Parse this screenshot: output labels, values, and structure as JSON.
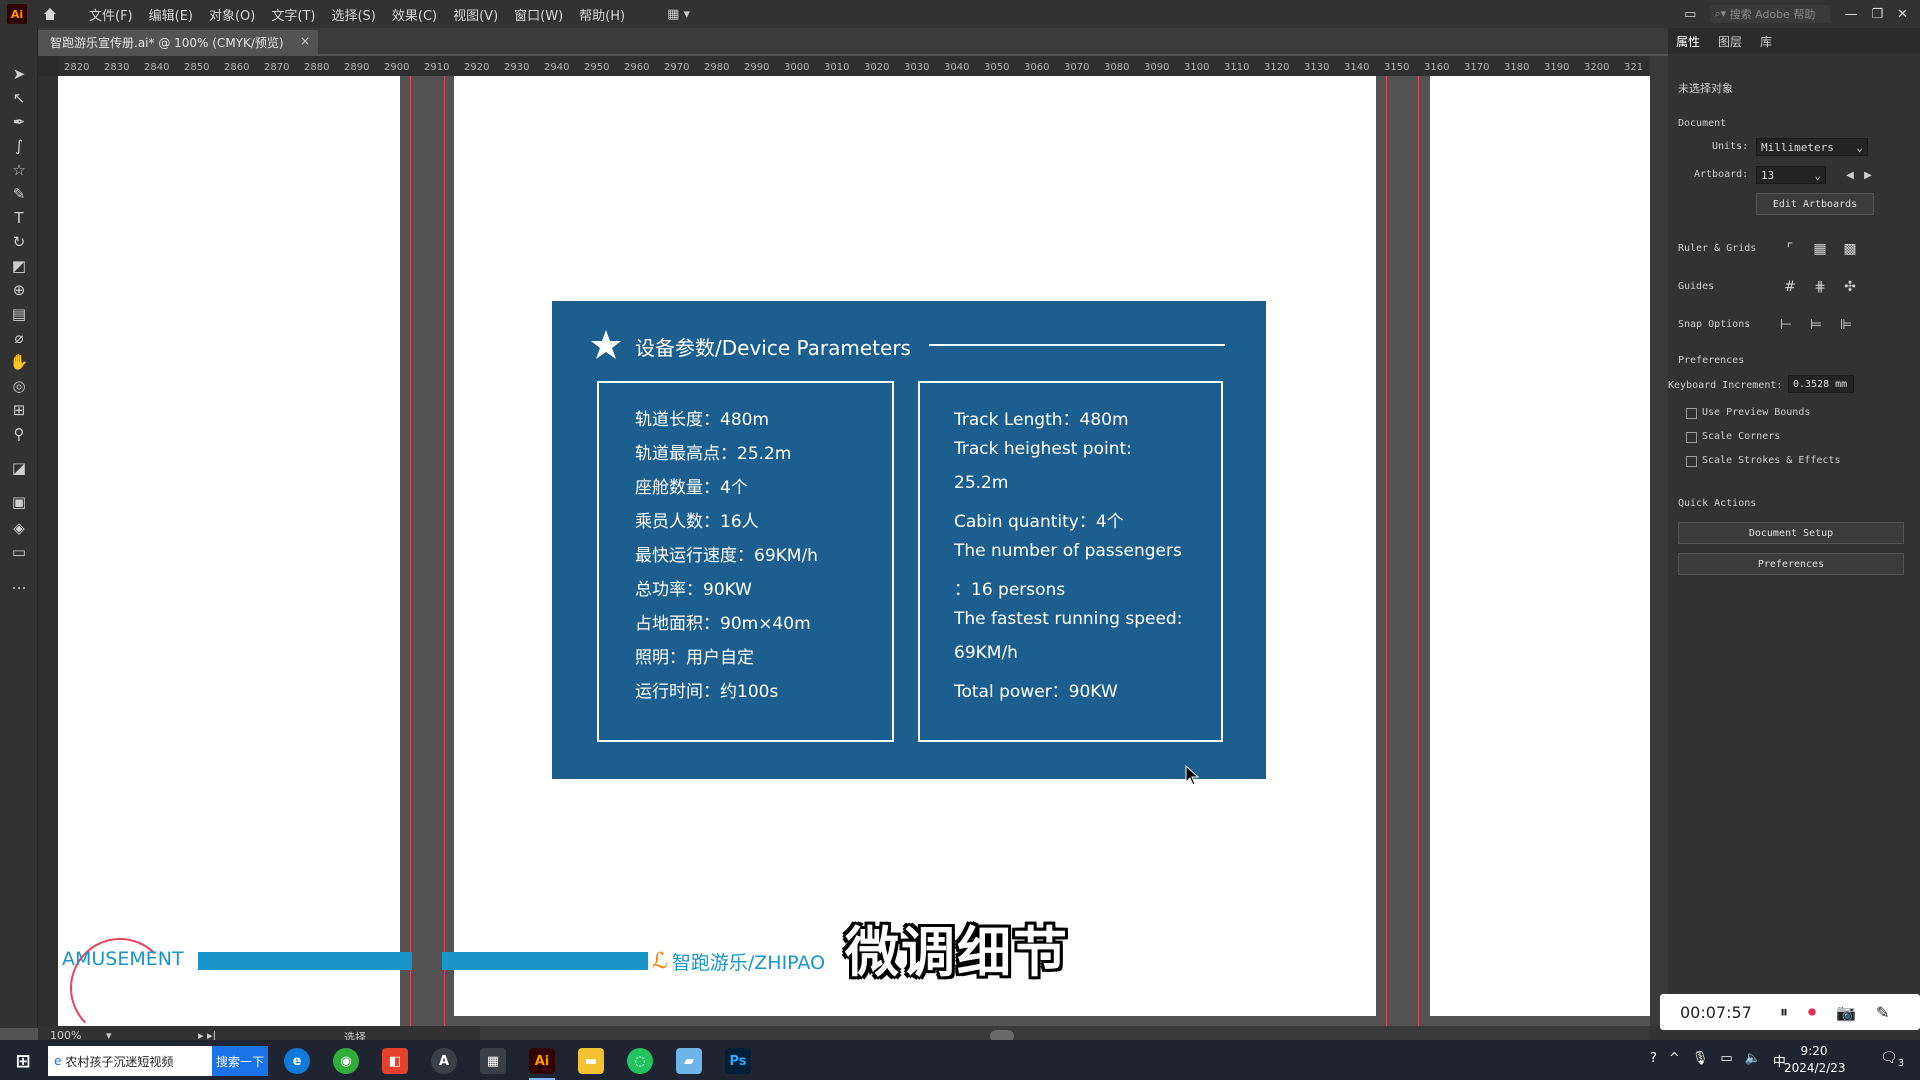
{
  "menubar": {
    "app_logo": "Ai",
    "menus": [
      "文件(F)",
      "编辑(E)",
      "对象(O)",
      "文字(T)",
      "选择(S)",
      "效果(C)",
      "视图(V)",
      "窗口(W)",
      "帮助(H)"
    ],
    "search_placeholder": "搜索 Adobe 帮助"
  },
  "document_tab": {
    "title": "智跑游乐宣传册.ai* @ 100% (CMYK/预览)",
    "close": "×"
  },
  "ruler": {
    "ticks": [
      "2820",
      "2830",
      "2840",
      "2850",
      "2860",
      "2870",
      "2880",
      "2890",
      "2900",
      "2910",
      "2920",
      "2930",
      "2940",
      "2950",
      "2960",
      "2970",
      "2980",
      "2990",
      "3000",
      "3010",
      "3020",
      "3030",
      "3040",
      "3050",
      "3060",
      "3070",
      "3080",
      "3090",
      "3100",
      "3110",
      "3120",
      "3130",
      "3140",
      "3150",
      "3160",
      "3170",
      "3180",
      "3190",
      "3200",
      "321"
    ]
  },
  "card": {
    "title": "设备参数/Device Parameters",
    "left_lines": [
      "轨道长度：480m",
      "轨道最高点：25.2m",
      "座舱数量：4个",
      "乘员人数：16人",
      "最快运行速度：69KM/h",
      "总功率：90KW",
      "占地面积：90m×40m",
      "照明：用户自定",
      "运行时间：约100s"
    ],
    "right_lines": [
      "Track Length：480m",
      "Track heighest point:",
      "25.2m",
      "Cabin quantity：4个",
      "The number of passengers",
      "：16 persons",
      "The fastest running speed:",
      "69KM/h",
      "Total power：90KW"
    ]
  },
  "bottom": {
    "amusement": "AMUSEMENT",
    "brand": "智跑游乐/ZHIPAO",
    "subtitle": "微调细节"
  },
  "statusbar": {
    "zoom": "100%",
    "tool": "选择"
  },
  "properties": {
    "tabs": [
      "属性",
      "图层",
      "库"
    ],
    "no_selection": "未选择对象",
    "document_label": "Document",
    "units_label": "Units:",
    "units_value": "Millimeters",
    "artboard_label": "Artboard:",
    "artboard_value": "13",
    "edit_artboards": "Edit Artboards",
    "ruler_grids": "Ruler & Grids",
    "guides": "Guides",
    "snap_options": "Snap Options",
    "preferences_label": "Preferences",
    "keyboard_increment_label": "Keyboard Increment:",
    "keyboard_increment_value": "0.3528 mm",
    "use_preview_bounds": "Use Preview Bounds",
    "scale_corners": "Scale Corners",
    "scale_strokes": "Scale Strokes & Effects",
    "quick_actions": "Quick Actions",
    "document_setup": "Document Setup",
    "preferences_button": "Preferences"
  },
  "recorder": {
    "time": "00:07:57"
  },
  "taskbar": {
    "search_text": "农村孩子沉迷短视频",
    "search_button": "搜索一下",
    "ime": "中",
    "time": "9:20",
    "date": "2024/2/23",
    "notifications": "3"
  }
}
